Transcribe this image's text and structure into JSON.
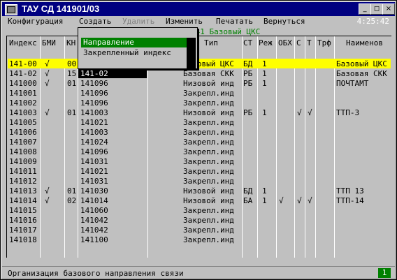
{
  "window": {
    "title": "ТАУ СД 141901/03",
    "clock": "4:25:42"
  },
  "menu": [
    "Конфигурация",
    "Создать",
    "Удалить",
    "Изменить",
    "Печатать",
    "Вернуться"
  ],
  "dropdown": {
    "item1": "Направление",
    "item2": "Закрепленный индекс"
  },
  "header_line": "141 Базовый ЦКС",
  "columns": [
    "Индекс",
    "БМИ",
    "КН",
    "Тип",
    "СТ",
    "Реж",
    "ОБХ",
    "С",
    "Т",
    "Трф",
    "Наименов"
  ],
  "rows": [
    {
      "idx": "141-00",
      "bmi": "√",
      "kn": "00",
      "code": "",
      "tip": "Базовый ЦКС",
      "st": "БД",
      "rej": "1",
      "obh": "",
      "c": "",
      "t": "",
      "trf": "",
      "name": "Базовый ЦКС"
    },
    {
      "idx": "141-02",
      "bmi": "√",
      "kn": "15",
      "code": "141-02",
      "tip": "Базовая СКК",
      "st": "РБ",
      "rej": "1",
      "obh": "",
      "c": "",
      "t": "",
      "trf": "",
      "name": "Базовая СКК"
    },
    {
      "idx": "141000",
      "bmi": "√",
      "kn": "01",
      "code": "141096",
      "tip": "Низовой инд",
      "st": "РБ",
      "rej": "1",
      "obh": "",
      "c": "",
      "t": "",
      "trf": "",
      "name": "ПОЧТАМТ"
    },
    {
      "idx": "141001",
      "bmi": "",
      "kn": "",
      "code": "141096",
      "tip": "Закрепл.инд",
      "st": "",
      "rej": "",
      "obh": "",
      "c": "",
      "t": "",
      "trf": "",
      "name": ""
    },
    {
      "idx": "141002",
      "bmi": "",
      "kn": "",
      "code": "141096",
      "tip": "Закрепл.инд",
      "st": "",
      "rej": "",
      "obh": "",
      "c": "",
      "t": "",
      "trf": "",
      "name": ""
    },
    {
      "idx": "141003",
      "bmi": "√",
      "kn": "01",
      "code": "141003",
      "tip": "Низовой инд",
      "st": "РБ",
      "rej": "1",
      "obh": "",
      "c": "√",
      "t": "√",
      "trf": "",
      "name": "ТТП-3"
    },
    {
      "idx": "141005",
      "bmi": "",
      "kn": "",
      "code": "141021",
      "tip": "Закрепл.инд",
      "st": "",
      "rej": "",
      "obh": "",
      "c": "",
      "t": "",
      "trf": "",
      "name": ""
    },
    {
      "idx": "141006",
      "bmi": "",
      "kn": "",
      "code": "141003",
      "tip": "Закрепл.инд",
      "st": "",
      "rej": "",
      "obh": "",
      "c": "",
      "t": "",
      "trf": "",
      "name": ""
    },
    {
      "idx": "141007",
      "bmi": "",
      "kn": "",
      "code": "141024",
      "tip": "Закрепл.инд",
      "st": "",
      "rej": "",
      "obh": "",
      "c": "",
      "t": "",
      "trf": "",
      "name": ""
    },
    {
      "idx": "141008",
      "bmi": "",
      "kn": "",
      "code": "141096",
      "tip": "Закрепл.инд",
      "st": "",
      "rej": "",
      "obh": "",
      "c": "",
      "t": "",
      "trf": "",
      "name": ""
    },
    {
      "idx": "141009",
      "bmi": "",
      "kn": "",
      "code": "141031",
      "tip": "Закрепл.инд",
      "st": "",
      "rej": "",
      "obh": "",
      "c": "",
      "t": "",
      "trf": "",
      "name": ""
    },
    {
      "idx": "141011",
      "bmi": "",
      "kn": "",
      "code": "141021",
      "tip": "Закрепл.инд",
      "st": "",
      "rej": "",
      "obh": "",
      "c": "",
      "t": "",
      "trf": "",
      "name": ""
    },
    {
      "idx": "141012",
      "bmi": "",
      "kn": "",
      "code": "141031",
      "tip": "Закрепл.инд",
      "st": "",
      "rej": "",
      "obh": "",
      "c": "",
      "t": "",
      "trf": "",
      "name": ""
    },
    {
      "idx": "141013",
      "bmi": "√",
      "kn": "01",
      "code": "141030",
      "tip": "Низовой инд",
      "st": "БД",
      "rej": "1",
      "obh": "",
      "c": "",
      "t": "",
      "trf": "",
      "name": "ТТП 13"
    },
    {
      "idx": "141014",
      "bmi": "√",
      "kn": "02",
      "code": "141014",
      "tip": "Низовой инд",
      "st": "БА",
      "rej": "1",
      "obh": "√",
      "c": "√",
      "t": "√",
      "trf": "",
      "name": "ТТП-14"
    },
    {
      "idx": "141015",
      "bmi": "",
      "kn": "",
      "code": "141060",
      "tip": "Закрепл.инд",
      "st": "",
      "rej": "",
      "obh": "",
      "c": "",
      "t": "",
      "trf": "",
      "name": ""
    },
    {
      "idx": "141016",
      "bmi": "",
      "kn": "",
      "code": "141042",
      "tip": "Закрепл.инд",
      "st": "",
      "rej": "",
      "obh": "",
      "c": "",
      "t": "",
      "trf": "",
      "name": ""
    },
    {
      "idx": "141017",
      "bmi": "",
      "kn": "",
      "code": "141042",
      "tip": "Закрепл.инд",
      "st": "",
      "rej": "",
      "obh": "",
      "c": "",
      "t": "",
      "trf": "",
      "name": ""
    },
    {
      "idx": "141018",
      "bmi": "",
      "kn": "",
      "code": "141100",
      "tip": "Закрепл.инд",
      "st": "",
      "rej": "",
      "obh": "",
      "c": "",
      "t": "",
      "trf": "",
      "name": ""
    }
  ],
  "status": {
    "text": "Организация базового направления связи",
    "page": "1"
  },
  "colors": {
    "title_bg": "#000080",
    "highlight": "#ffff00",
    "menu_sel": "#008000",
    "header_line": "#008000"
  }
}
